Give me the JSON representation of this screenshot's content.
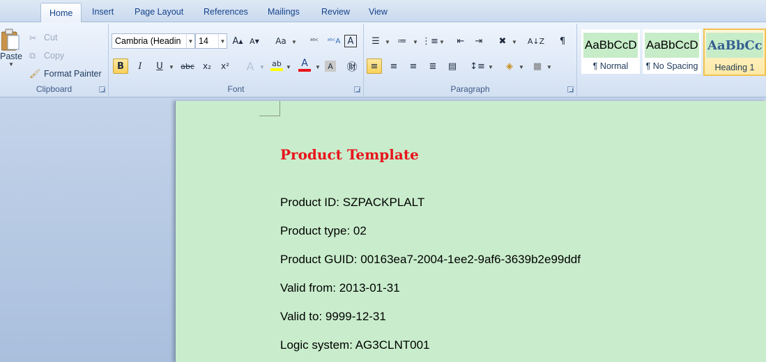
{
  "tabs": [
    {
      "label": "Home",
      "active": true
    },
    {
      "label": "Insert",
      "active": false
    },
    {
      "label": "Page Layout",
      "active": false
    },
    {
      "label": "References",
      "active": false
    },
    {
      "label": "Mailings",
      "active": false
    },
    {
      "label": "Review",
      "active": false
    },
    {
      "label": "View",
      "active": false
    }
  ],
  "clipboard": {
    "paste_label": "Paste",
    "cut_label": "Cut",
    "copy_label": "Copy",
    "format_painter_label": "Format Painter",
    "group_label": "Clipboard"
  },
  "font": {
    "font_name": "Cambria (Headin",
    "font_size": "14",
    "group_label": "Font",
    "font_color": "#e8141b",
    "highlight_color": "#ffff00"
  },
  "paragraph": {
    "group_label": "Paragraph"
  },
  "styles": [
    {
      "preview": "AaBbCcD",
      "name": "¶ Normal",
      "selected": false
    },
    {
      "preview": "AaBbCcD",
      "name": "¶ No Spacing",
      "selected": false
    },
    {
      "preview": "AaBbCc",
      "name": "Heading 1",
      "selected": true
    }
  ],
  "document": {
    "title": "Product Template",
    "lines": [
      "Product ID: SZPACKPLALT",
      "Product type: 02",
      "Product GUID: 00163ea7-2004-1ee2-9af6-3639b2e99ddf",
      "Valid from: 2013-01-31",
      "Valid to: 9999-12-31",
      "Logic system: AG3CLNT001"
    ],
    "page_color": "#c9edcc",
    "title_color": "#e8141b"
  }
}
